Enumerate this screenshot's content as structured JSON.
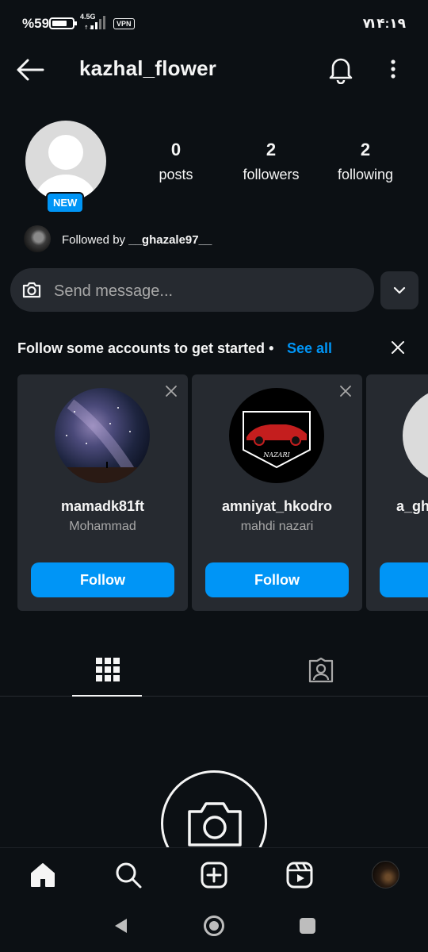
{
  "status_bar": {
    "battery": "%59",
    "network": "4.5G",
    "vpn": "VPN",
    "sim": "۷",
    "time": "۱۴:۱۹"
  },
  "header": {
    "username": "kazhal_flower"
  },
  "profile": {
    "badge": "NEW",
    "stats": [
      {
        "value": "0",
        "label": "posts"
      },
      {
        "value": "2",
        "label": "followers"
      },
      {
        "value": "2",
        "label": "following"
      }
    ],
    "followed_by_prefix": "Followed by ",
    "followed_by_user": "__ghazale97__"
  },
  "message": {
    "placeholder": "Send message..."
  },
  "suggestions": {
    "title": "Follow some accounts to get started",
    "separator": "•",
    "see_all": "See all",
    "cards": [
      {
        "username": "mamadk81ft",
        "name": "Mohammad",
        "button": "Follow"
      },
      {
        "username": "amniyat_hkodro",
        "name": "mahdi nazari",
        "button": "Follow",
        "avatar_logo_text": "NAZARI"
      }
    ],
    "partial_card_username": "a_gh"
  },
  "colors": {
    "background": "#0c1014",
    "card": "#262a30",
    "accent": "#0095f6"
  }
}
